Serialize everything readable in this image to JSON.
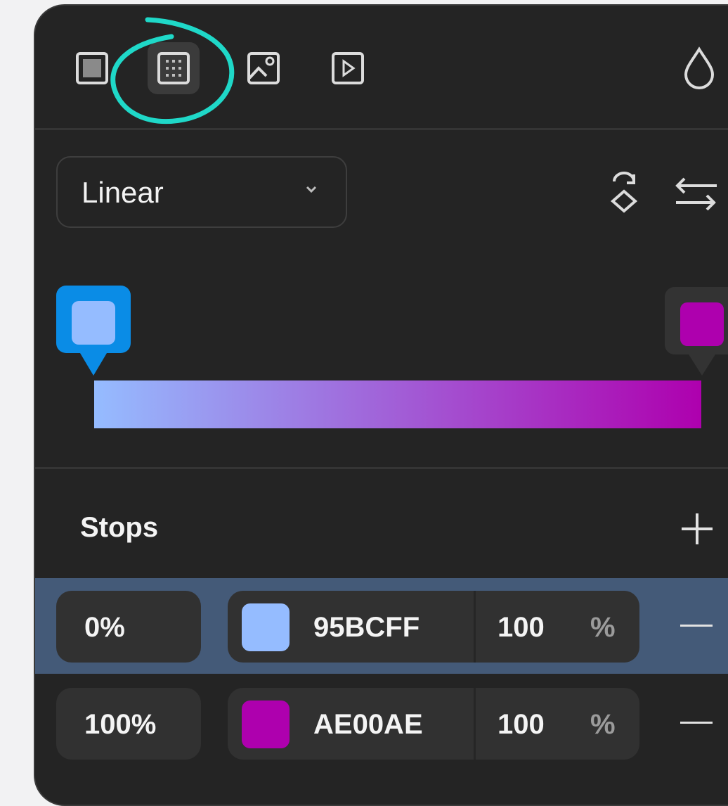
{
  "toolbar": {
    "icons": [
      "fill-solid-icon",
      "fill-gradient-icon",
      "fill-image-icon",
      "fill-video-icon",
      "opacity-drop-icon"
    ],
    "active": "fill-gradient-icon"
  },
  "gradient": {
    "type_label": "Linear",
    "rotate_icon": "rotate-icon",
    "swap_icon": "swap-icon",
    "start_color": "#95BCFF",
    "end_color": "#AE00AE"
  },
  "stops": {
    "title": "Stops",
    "add_icon": "plus-icon",
    "items": [
      {
        "position": "0%",
        "hex": "95BCFF",
        "color": "#95BCFF",
        "opacity": "100",
        "unit": "%",
        "selected": true
      },
      {
        "position": "100%",
        "hex": "AE00AE",
        "color": "#AE00AE",
        "opacity": "100",
        "unit": "%",
        "selected": false
      }
    ]
  },
  "colors": {
    "panel": "#242424",
    "selected_row": "#445A78",
    "selected_handle": "#0A8CE6",
    "annotation": "#1FD8C8"
  }
}
